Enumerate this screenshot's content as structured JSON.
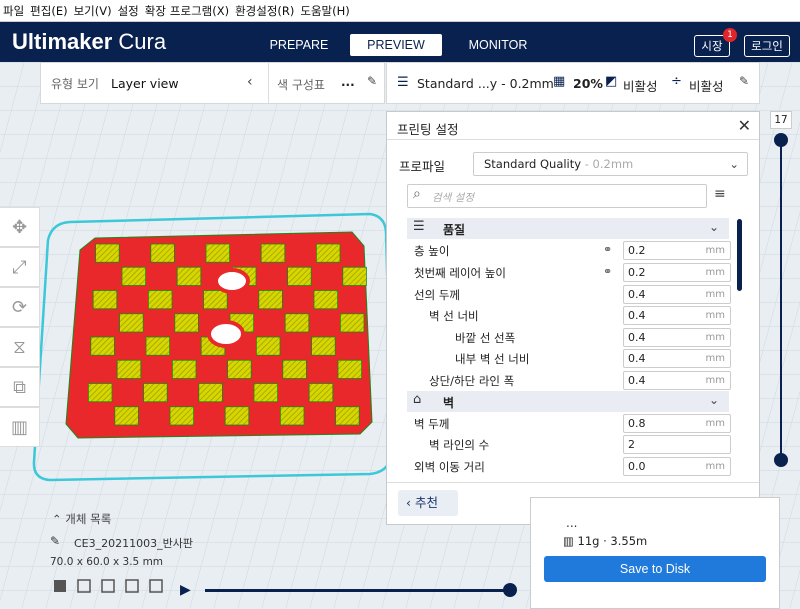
{
  "menubar": [
    "파일",
    "편집(E)",
    "보기(V)",
    "설정",
    "확장",
    "프로그램(X)",
    "환경설정(R)",
    "도움말(H)"
  ],
  "header": {
    "logo_bold": "Ultimaker",
    "logo_light": " Cura",
    "stages": [
      "PREPARE",
      "PREVIEW",
      "MONITOR"
    ],
    "active_stage": "PREVIEW",
    "market_label": "시장",
    "market_badge": "1",
    "login_label": "로그인"
  },
  "viewbar": {
    "view_type_label": "유형 보기",
    "view_type_value": "Layer view",
    "color_scheme_label": "색 구성표",
    "color_scheme_value": "..."
  },
  "printbar": {
    "profile": "Standard ...y - 0.2mm",
    "infill": "20%",
    "support": "비활성",
    "adhesion": "비활성"
  },
  "panel": {
    "title": "프린팅 설정",
    "profile_label": "프로파일",
    "profile_value": "Standard Quality",
    "profile_muted": " - 0.2mm",
    "search_placeholder": "검색 설정",
    "recommended_label": "추천",
    "categories": [
      {
        "label": "품질"
      },
      {
        "label": "벽"
      }
    ],
    "quality_rows": [
      {
        "label": "층 높이",
        "value": "0.2",
        "unit": "mm",
        "linked": true
      },
      {
        "label": "첫번째 레이어 높이",
        "value": "0.2",
        "unit": "mm",
        "linked": true
      },
      {
        "label": "선의 두께",
        "value": "0.4",
        "unit": "mm",
        "linked": false
      },
      {
        "label": "벽 선 너비",
        "value": "0.4",
        "unit": "mm",
        "linked": false
      },
      {
        "label": "바깥 선 선폭",
        "value": "0.4",
        "unit": "mm",
        "linked": false
      },
      {
        "label": "내부 벽 선 너비",
        "value": "0.4",
        "unit": "mm",
        "linked": false
      },
      {
        "label": "상단/하단 라인 폭",
        "value": "0.4",
        "unit": "mm",
        "linked": false
      }
    ],
    "wall_rows": [
      {
        "label": "벽 두께",
        "value": "0.8",
        "unit": "mm"
      },
      {
        "label": "벽 라인의 수",
        "value": "2",
        "unit": ""
      },
      {
        "label": "외벽 이동 거리",
        "value": "0.0",
        "unit": "mm"
      }
    ]
  },
  "layer_slider": {
    "value": "17",
    "upper_fraction": 1.0,
    "lower_fraction": 0.0
  },
  "object": {
    "list_label": "개체 목록",
    "name": "CE3_20211003_반사판",
    "dims": "70.0 x 60.0 x 3.5 mm"
  },
  "output": {
    "dots": "...",
    "estimate": "11g · 3.55m",
    "save_label": "Save to Disk"
  },
  "colors": {
    "header": "#09214f",
    "accent": "#1f7adb",
    "model_top": "#d8d800",
    "model_wall": "#e8282a",
    "buildplate_outline": "#3cc8d8"
  }
}
